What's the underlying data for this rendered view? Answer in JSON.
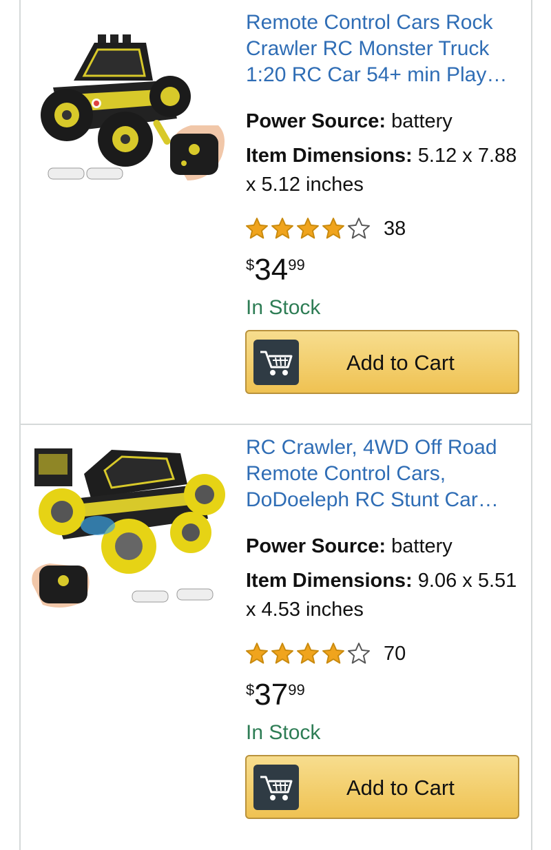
{
  "products": [
    {
      "title": "Remote Control Cars Rock Crawler RC Monster Truck 1:20 RC Car 54+ min Play…",
      "power_source_label": "Power Source:",
      "power_source_value": "battery",
      "dimensions_label": "Item Dimensions:",
      "dimensions_value": "5.12 x 7.88 x 5.12 inches",
      "rating_value": 4,
      "rating_count": "38",
      "price_symbol": "$",
      "price_whole": "34",
      "price_fraction": "99",
      "stock": "In Stock",
      "cart_label": "Add to Cart",
      "image_icon": "rc-car-product-image"
    },
    {
      "title": "RC Crawler, 4WD Off Road Remote Control Cars, DoDoeleph RC Stunt Car…",
      "power_source_label": "Power Source:",
      "power_source_value": "battery",
      "dimensions_label": "Item Dimensions:",
      "dimensions_value": "9.06 x 5.51 x 4.53 inches",
      "rating_value": 4,
      "rating_count": "70",
      "price_symbol": "$",
      "price_whole": "37",
      "price_fraction": "99",
      "stock": "In Stock",
      "cart_label": "Add to Cart",
      "image_icon": "rc-stunt-car-product-image"
    }
  ],
  "colors": {
    "link": "#2f6db5",
    "stock": "#2e7d55",
    "star": "#f0a41d",
    "button_top": "#f7dd8e",
    "button_bottom": "#efc252"
  }
}
